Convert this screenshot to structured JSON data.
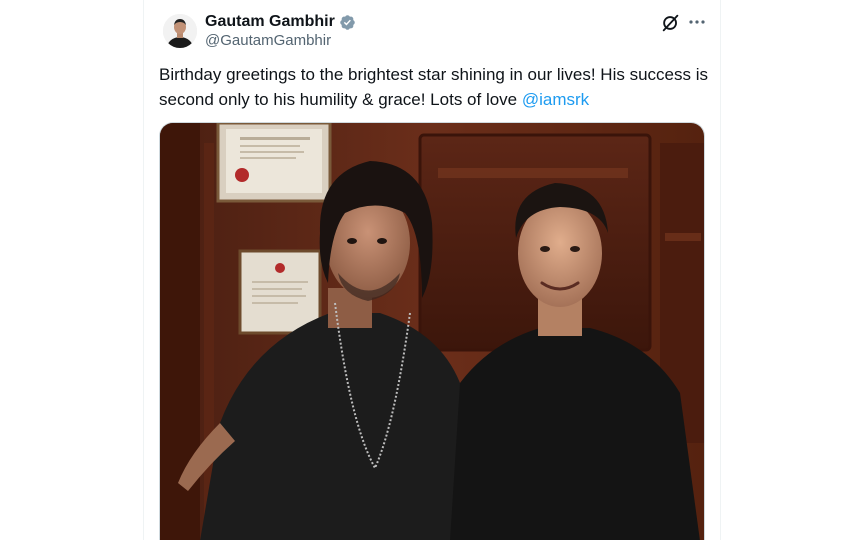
{
  "author": {
    "display_name": "Gautam Gambhir",
    "handle": "@GautamGambhir",
    "verified": true
  },
  "tweet": {
    "text_before_mention": "Birthday greetings to the brightest star shining in our lives! His success is second only to his humility & grace! Lots of love ",
    "mention": "@iamsrk"
  },
  "icons": {
    "verified": "verified-badge-icon",
    "grok": "grok-icon",
    "more": "more-options-icon"
  },
  "colors": {
    "link": "#1d9bf0",
    "text": "#0f1419",
    "secondary_text": "#536471",
    "verified_badge": "#829aab"
  }
}
